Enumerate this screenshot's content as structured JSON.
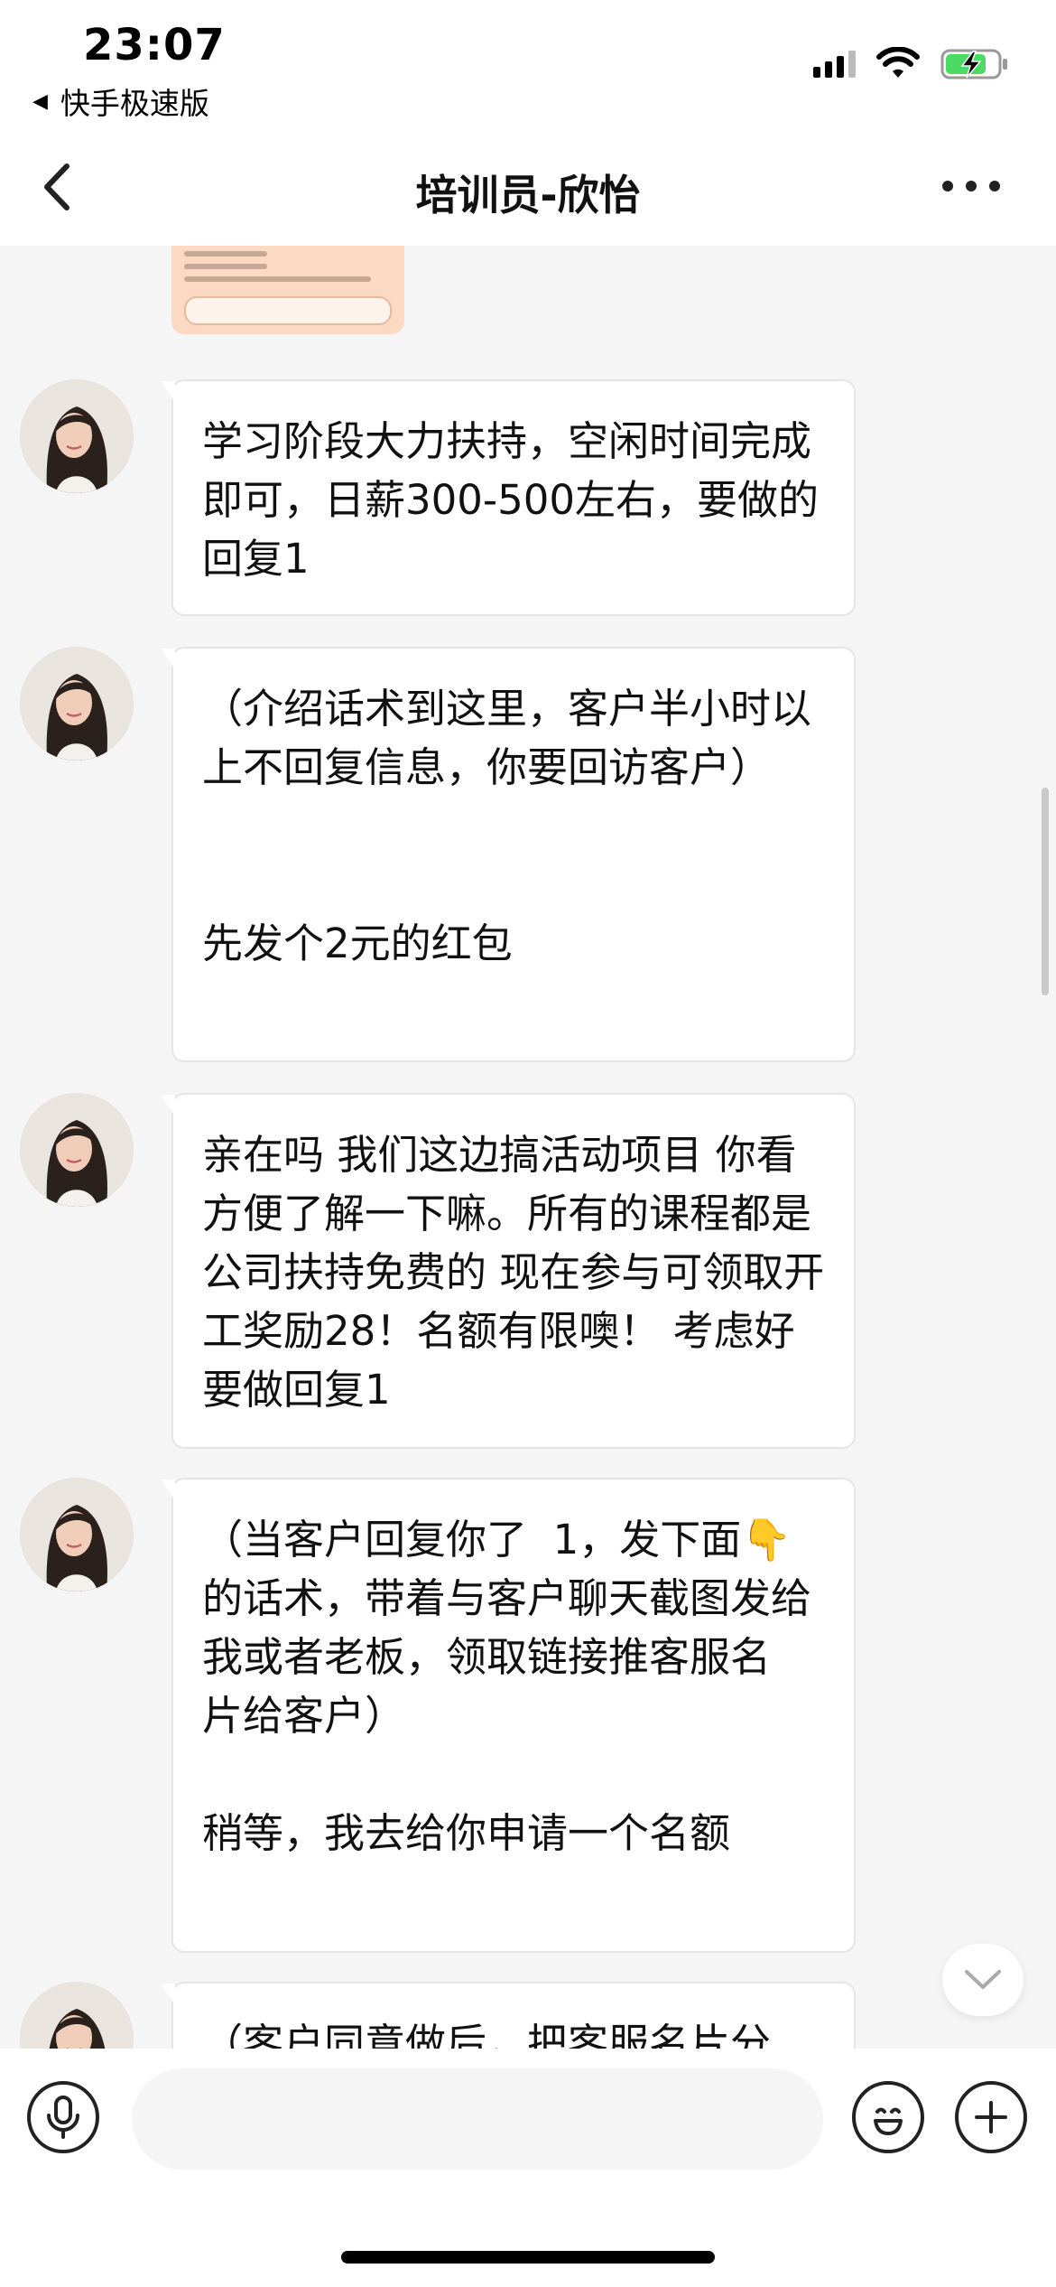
{
  "status_bar": {
    "time": "23:07",
    "back_app_label": "快手极速版",
    "icons": [
      "cellular-signal-icon",
      "wifi-icon",
      "battery-charging-icon"
    ]
  },
  "nav": {
    "title": "培训员-欣怡",
    "back_icon": "chevron-left-icon",
    "more_icon": "more-horizontal-icon"
  },
  "messages": [
    {
      "sender": "培训员-欣怡",
      "text": "学习阶段大力扶持，空闲时间完成即可，日薪300-500左右，要做的回复1"
    },
    {
      "sender": "培训员-欣怡",
      "text": "（介绍话术到这里，客户半小时以上不回复信息，你要回访客户）\n\n\n先发个2元的红包"
    },
    {
      "sender": "培训员-欣怡",
      "text": "亲在吗 我们这边搞活动项目 你看方便了解一下嘛。所有的课程都是公司扶持免费的 现在参与可领取开工奖励28！名额有限噢！ 考虑好要做回复1"
    },
    {
      "sender": "培训员-欣怡",
      "text": "（当客户回复你了  1，发下面👇的话术，带着与客户聊天截图发给我或者老板，领取链接推客服名\n片给客户）\n\n稍等，我去给你申请一个名额"
    },
    {
      "sender": "培训员-欣怡",
      "text": "（客户同意做后，把客服名片分"
    }
  ],
  "input_bar": {
    "placeholder": "",
    "icons": [
      "microphone-icon",
      "emoji-icon",
      "plus-icon"
    ]
  },
  "colors": {
    "background": "#f5f5f5",
    "bubble": "#ffffff",
    "bubble_border": "#e5e5e5"
  }
}
